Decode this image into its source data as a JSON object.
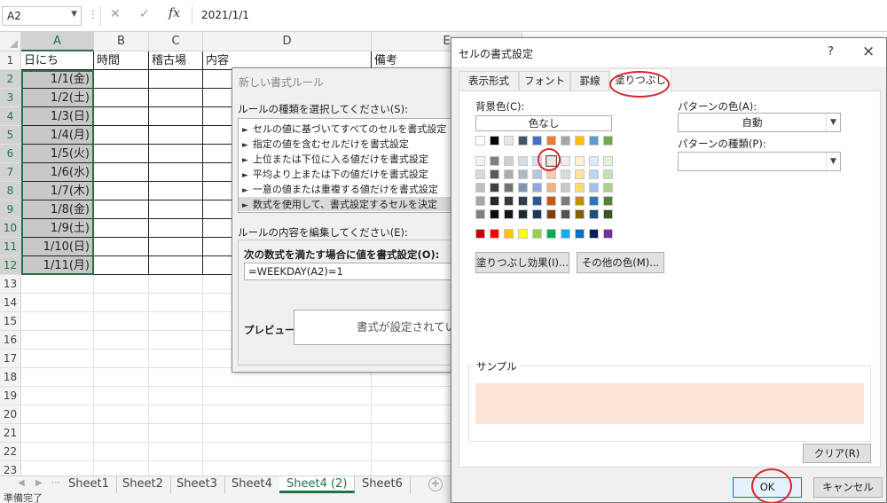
{
  "formula_bar": {
    "name_box": "A2",
    "formula": "2021/1/1"
  },
  "sheet": {
    "columns": [
      "A",
      "B",
      "C",
      "D",
      "E"
    ],
    "rows": [
      "1",
      "2",
      "3",
      "4",
      "5",
      "6",
      "7",
      "8",
      "9",
      "10",
      "11",
      "12",
      "13",
      "14",
      "15",
      "16",
      "17",
      "18",
      "19",
      "20",
      "21",
      "22",
      "23"
    ],
    "headers": {
      "A": "日にち",
      "B": "時間",
      "C": "稽古場",
      "D": "内容",
      "E": "備考"
    },
    "dates": [
      "1/1(金)",
      "1/2(土)",
      "1/3(日)",
      "1/4(月)",
      "1/5(火)",
      "1/6(水)",
      "1/7(木)",
      "1/8(金)",
      "1/9(土)",
      "1/10(日)",
      "1/11(月)"
    ]
  },
  "tabs": [
    "Sheet1",
    "Sheet2",
    "Sheet3",
    "Sheet4",
    "Sheet4 (2)",
    "Sheet6"
  ],
  "active_tab": "Sheet4 (2)",
  "status": "準備完了",
  "rule_dialog": {
    "title": "新しい書式ルール",
    "select_label": "ルールの種類を選択してください(S):",
    "rule_types": [
      "セルの値に基づいてすべてのセルを書式設定",
      "指定の値を含むセルだけを書式設定",
      "上位または下位に入る値だけを書式設定",
      "平均より上または下の値だけを書式設定",
      "一意の値または重複する値だけを書式設定",
      "数式を使用して、書式設定するセルを決定"
    ],
    "edit_label": "ルールの内容を編集してください(E):",
    "formula_label": "次の数式を満たす場合に値を書式設定(O):",
    "formula": "=WEEKDAY(A2)=1",
    "preview_label": "プレビュー:",
    "preview_text": "書式が設定されてい"
  },
  "format_dialog": {
    "title": "セルの書式設定",
    "help": "?",
    "close": "×",
    "tabs": [
      "表示形式",
      "フォント",
      "罫線",
      "塗りつぶし"
    ],
    "active_tab": "塗りつぶし",
    "background_label": "背景色(C):",
    "no_color": "色なし",
    "fill_effects": "塗りつぶし効果(I)...",
    "more_colors": "その他の色(M)...",
    "pattern_color_label": "パターンの色(A):",
    "pattern_color_value": "自動",
    "pattern_style_label": "パターンの種類(P):",
    "pattern_style_value": "",
    "sample_label": "サンプル",
    "clear": "クリア(R)",
    "ok": "OK",
    "cancel": "キャンセル",
    "sample_color": "#fce4d6",
    "theme_colors": [
      "#ffffff",
      "#000000",
      "#e7e6e6",
      "#44546a",
      "#4472c4",
      "#ed7d31",
      "#a5a5a5",
      "#ffc000",
      "#5b9bd5",
      "#70ad47"
    ],
    "shade_rows": [
      [
        "#f2f2f2",
        "#7f7f7f",
        "#d0cece",
        "#d6dce4",
        "#d9e1f2",
        "#fce4d6",
        "#ededed",
        "#fff2cc",
        "#ddebf7",
        "#e2efda"
      ],
      [
        "#d9d9d9",
        "#595959",
        "#aeaaaa",
        "#acb9ca",
        "#b4c6e7",
        "#f8cbad",
        "#dbdbdb",
        "#ffe699",
        "#bdd7ee",
        "#c6e0b4"
      ],
      [
        "#bfbfbf",
        "#404040",
        "#757171",
        "#8497b0",
        "#8ea9db",
        "#f4b084",
        "#c9c9c9",
        "#ffd966",
        "#9bc2e6",
        "#a9d08e"
      ],
      [
        "#a6a6a6",
        "#262626",
        "#3a3838",
        "#333f4f",
        "#2f5597",
        "#c65911",
        "#7b7b7b",
        "#bf8f00",
        "#2f75b5",
        "#548235"
      ],
      [
        "#808080",
        "#0d0d0d",
        "#161616",
        "#222b35",
        "#203764",
        "#833c0c",
        "#525252",
        "#806000",
        "#1f4e78",
        "#375623"
      ]
    ],
    "standard_colors": [
      "#c00000",
      "#ff0000",
      "#ffc000",
      "#ffff00",
      "#92d050",
      "#00b050",
      "#00b0f0",
      "#0070c0",
      "#002060",
      "#7030a0"
    ],
    "selected_swatch": "#fce4d6"
  }
}
